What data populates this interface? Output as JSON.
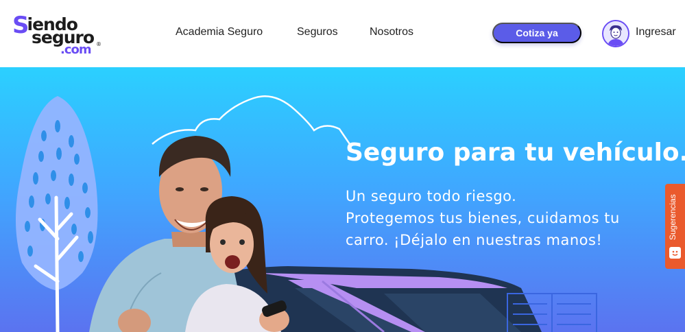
{
  "brand": {
    "logo_line1_initial": "S",
    "logo_line1_rest": "iendo",
    "logo_line2": "seguro",
    "logo_line3": ".com",
    "logo_reg": "®",
    "accent_color": "#6a4df4"
  },
  "nav": {
    "items": [
      {
        "label": "Academia Seguro"
      },
      {
        "label": "Seguros"
      },
      {
        "label": "Nosotros"
      }
    ]
  },
  "header": {
    "cta_label": "Cotiza ya",
    "cta_color": "#5b5ce8",
    "login_label": "Ingresar",
    "avatar_icon": "user-avatar-icon"
  },
  "hero": {
    "title": "Seguro para tu vehículo.",
    "subtitle_lines": [
      "Un seguro todo riesgo.",
      "Protegemos tus bienes, cuidamos tu",
      "carro. ¡Déjalo en nuestras manos!"
    ],
    "background_top": "#2bd0ff",
    "background_bottom": "#5b73f0"
  },
  "feedback": {
    "label": "Sugerencias",
    "icon": "smile-icon",
    "color": "#ea5a2d"
  }
}
